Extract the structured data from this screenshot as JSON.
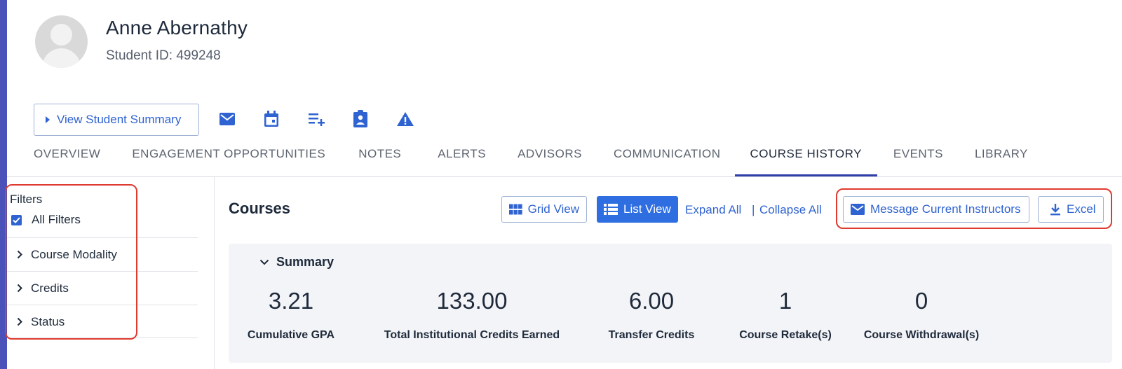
{
  "student": {
    "name": "Anne Abernathy",
    "id_text": "Student ID: 499248"
  },
  "actions": {
    "summary_button": "View Student Summary",
    "icons": [
      "mail-icon",
      "calendar-icon",
      "playlist-add-icon",
      "assignment-ind-icon",
      "warning-icon"
    ]
  },
  "tabs": [
    {
      "label": "OVERVIEW",
      "active": false
    },
    {
      "label": "ENGAGEMENT OPPORTUNITIES",
      "active": false
    },
    {
      "label": "NOTES",
      "active": false
    },
    {
      "label": "ALERTS",
      "active": false
    },
    {
      "label": "ADVISORS",
      "active": false
    },
    {
      "label": "COMMUNICATION",
      "active": false
    },
    {
      "label": "COURSE HISTORY",
      "active": true
    },
    {
      "label": "EVENTS",
      "active": false
    },
    {
      "label": "LIBRARY",
      "active": false
    }
  ],
  "filters": {
    "title": "Filters",
    "all_filters_label": "All Filters",
    "all_filters_checked": true,
    "groups": [
      {
        "label": "Course Modality"
      },
      {
        "label": "Credits"
      },
      {
        "label": "Status"
      }
    ]
  },
  "main": {
    "title": "Courses",
    "grid_view": "Grid View",
    "list_view": "List View",
    "expand_all": "Expand All",
    "separator": "|",
    "collapse_all": "Collapse All",
    "message_instructors": "Message Current Instructors",
    "excel": "Excel"
  },
  "summary": {
    "label": "Summary",
    "stats": [
      {
        "value": "3.21",
        "label": "Cumulative GPA"
      },
      {
        "value": "133.00",
        "label": "Total Institutional Credits Earned"
      },
      {
        "value": "6.00",
        "label": "Transfer Credits"
      },
      {
        "value": "1",
        "label": "Course Retake(s)"
      },
      {
        "value": "0",
        "label": "Course Withdrawal(s)"
      }
    ]
  },
  "colors": {
    "accent": "#2f63d1",
    "rail": "#4a51b8",
    "highlight": "#e03b30",
    "tab_underline": "#2f3fa8"
  }
}
